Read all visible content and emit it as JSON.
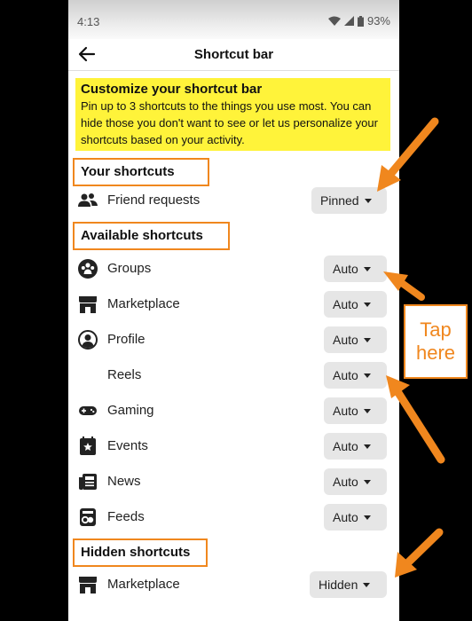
{
  "status": {
    "time": "4:13",
    "battery": "93%"
  },
  "header": {
    "title": "Shortcut bar"
  },
  "banner": {
    "title": "Customize your shortcut bar",
    "body": "Pin up to 3 shortcuts to the things you use most. You can hide those you don't want to see or let us personalize your shortcuts based on your activity."
  },
  "sections": {
    "your": "Your shortcuts",
    "available": "Available shortcuts",
    "hidden": "Hidden shortcuts"
  },
  "your_items": [
    {
      "label": "Friend requests",
      "state": "Pinned",
      "icon": "friends-icon"
    }
  ],
  "available_items": [
    {
      "label": "Groups",
      "state": "Auto",
      "icon": "groups-icon"
    },
    {
      "label": "Marketplace",
      "state": "Auto",
      "icon": "marketplace-icon"
    },
    {
      "label": "Profile",
      "state": "Auto",
      "icon": "profile-icon"
    },
    {
      "label": "Reels",
      "state": "Auto",
      "icon": ""
    },
    {
      "label": "Gaming",
      "state": "Auto",
      "icon": "gaming-icon"
    },
    {
      "label": "Events",
      "state": "Auto",
      "icon": "events-icon"
    },
    {
      "label": "News",
      "state": "Auto",
      "icon": "news-icon"
    },
    {
      "label": "Feeds",
      "state": "Auto",
      "icon": "feeds-icon"
    }
  ],
  "hidden_items": [
    {
      "label": "Marketplace",
      "state": "Hidden",
      "icon": "marketplace-icon"
    }
  ],
  "callout": {
    "line1": "Tap",
    "line2": "here"
  },
  "colors": {
    "accent": "#f0871e",
    "banner": "#fff33a"
  }
}
